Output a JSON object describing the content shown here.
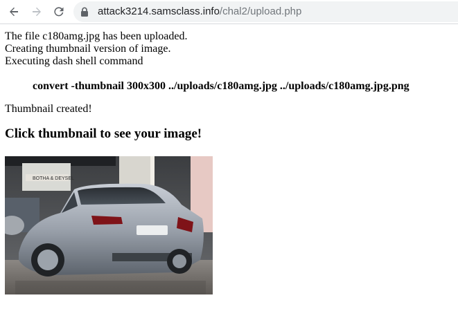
{
  "browser": {
    "url_host": "attack3214.samsclass.info",
    "url_path": "/chal2/upload.php",
    "icons": [
      "back-arrow-icon",
      "forward-arrow-icon",
      "reload-icon",
      "lock-icon"
    ]
  },
  "page": {
    "line1": "The file c180amg.jpg has been uploaded.",
    "line2": "Creating thumbnail version of image.",
    "line3": "Executing dash shell command",
    "command": "convert -thumbnail 300x300 ../uploads/c180amg.jpg ../uploads/c180amg.jpg.png",
    "created": "Thumbnail created!",
    "heading": "Click thumbnail to see your image!",
    "dealer_sign": "BOTHA & DEYSEL"
  }
}
